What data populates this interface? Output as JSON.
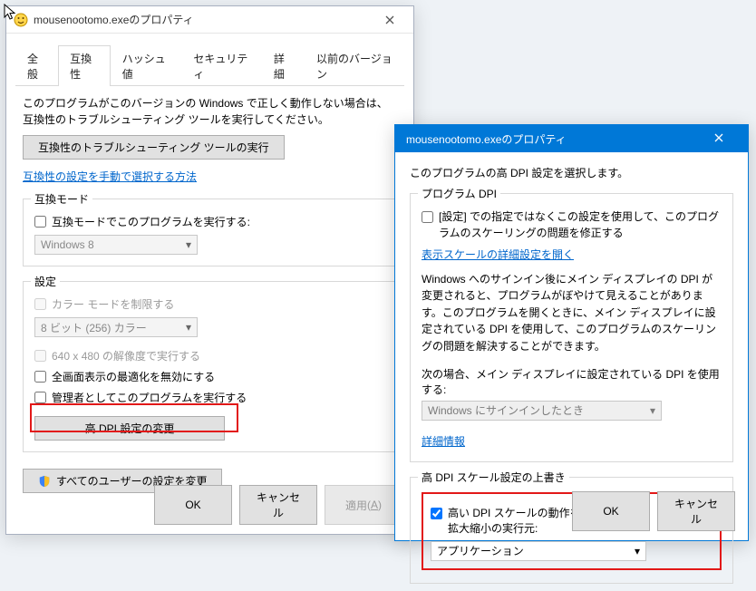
{
  "win1": {
    "title": "mousenootomo.exeのプロパティ",
    "tabs": [
      "全般",
      "互換性",
      "ハッシュ値",
      "セキュリティ",
      "詳細",
      "以前のバージョン"
    ],
    "active_tab": 1,
    "intro": "このプログラムがこのバージョンの Windows で正しく動作しない場合は、互換性のトラブルシューティング ツールを実行してください。",
    "troubleshoot_btn": "互換性のトラブルシューティング ツールの実行",
    "manual_link": "互換性の設定を手動で選択する方法",
    "group_compat": {
      "title": "互換モード",
      "chk_run_compat": "互換モードでこのプログラムを実行する:",
      "os_value": "Windows 8"
    },
    "group_settings": {
      "title": "設定",
      "chk_color": "カラー モードを制限する",
      "color_value": "8 ビット (256) カラー",
      "chk_640": "640 x 480 の解像度で実行する",
      "chk_fullscreen": "全画面表示の最適化を無効にする",
      "chk_admin": "管理者としてこのプログラムを実行する",
      "dpi_btn": "高 DPI 設定の変更"
    },
    "all_users_btn": "すべてのユーザーの設定を変更",
    "ok": "OK",
    "cancel": "キャンセル",
    "apply": "適用",
    "apply_accel": "A"
  },
  "win2": {
    "title": "mousenootomo.exeのプロパティ",
    "intro": "このプログラムの高 DPI 設定を選択します。",
    "group_prog_dpi": {
      "title": "プログラム DPI",
      "chk_text": "[設定] での指定ではなくこの設定を使用して、このプログラムのスケーリングの問題を修正する",
      "open_link": "表示スケールの詳細設定を開く",
      "explain": "Windows へのサインイン後にメイン ディスプレイの DPI が変更されると、プログラムがぼやけて見えることがあります。このプログラムを開くときに、メイン ディスプレイに設定されている DPI を使用して、このプログラムのスケーリングの問題を解決することができます。",
      "next_label": "次の場合、メイン ディスプレイに設定されている DPI を使用する:",
      "when_value": "Windows にサインインしたとき",
      "detail_link": "詳細情報"
    },
    "group_override": {
      "title": "高 DPI スケール設定の上書き",
      "chk_text1": "高い DPI スケールの動作を上書きします。",
      "chk_text2": "拡大縮小の実行元:",
      "scaling_value": "アプリケーション"
    },
    "ok": "OK",
    "cancel": "キャンセル"
  }
}
